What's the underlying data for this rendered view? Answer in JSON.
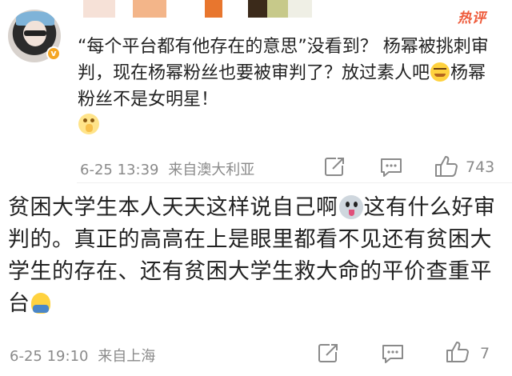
{
  "header": {
    "hot_label": "热评",
    "redaction_colors": [
      "#f5ddd3",
      "#ffffff",
      "#f2a36b",
      "#ffffff",
      "#e8762e",
      "#ffffff",
      "#3b2a1a",
      "#c7c98a",
      "#efefe5"
    ]
  },
  "comments": [
    {
      "avatar_badge": "v",
      "text_parts": [
        "“每个平台都有他存在的意思”没看到？ 杨幂被挑刺审判，现在杨幂粉丝也要被审判了？放过素人吧",
        "杨幂粉丝不是女明星！"
      ],
      "emojis": [
        "sweat-smile-icon",
        "pray-face-icon"
      ],
      "date": "6-25",
      "time": "13:39",
      "source": "来自澳大利亚",
      "likes": "743"
    },
    {
      "text_parts": [
        "贫困大学生本人天天这样说自己啊",
        "这有什么好审判的。真正的高高在上是眼里都看不见还有贫困大学生的存在、还有贫困大学生救大命的平价查重平台"
      ],
      "emojis": [
        "husky-dog-icon",
        "sitting-figure-icon"
      ],
      "date": "6-25",
      "time": "19:10",
      "source": "来自上海",
      "likes": "7"
    }
  ],
  "colors": {
    "hot": "#ee5a3a",
    "meta": "#8a8a8a",
    "text": "#222222",
    "badge": "#f5a623"
  }
}
